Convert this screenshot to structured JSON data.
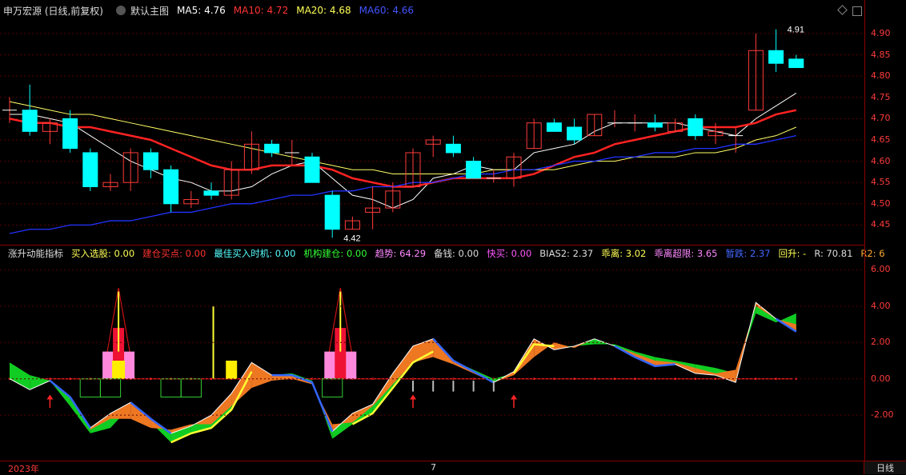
{
  "main_header": {
    "title": "申万宏源 (日线,前复权)",
    "preset": "默认主图",
    "ma5": "MA5: 4.76",
    "ma10": "MA10: 4.72",
    "ma20": "MA20: 4.68",
    "ma60": "MA60: 4.66"
  },
  "sub_header": {
    "title": "涨升动能指标",
    "buy_select": "买入选股: 0.00",
    "build_point": "建仓买点: 0.00",
    "best_time": "最佳买入时机: 0.00",
    "inst_build": "机构建仓: 0.00",
    "trend": "趋势: 64.29",
    "reserve": "备钱: 0.00",
    "fast_buy": "快买: 0.00",
    "bias2": "BIAS2: 2.37",
    "deviation": "乖离: 3.02",
    "deviation_limit": "乖离超限: 3.65",
    "fall": "暂跌: 2.37",
    "rise": "回升: -",
    "r": "R: 70.81",
    "r2": "R2: 6"
  },
  "main_axis": {
    "ticks": [
      "4.90",
      "4.85",
      "4.80",
      "4.75",
      "4.70",
      "4.65",
      "4.60",
      "4.55",
      "4.50",
      "4.45"
    ],
    "values": [
      4.9,
      4.85,
      4.8,
      4.75,
      4.7,
      4.65,
      4.6,
      4.55,
      4.5,
      4.45
    ]
  },
  "sub_axis": {
    "ticks": [
      "6.00",
      "4.00",
      "2.00",
      "0.00",
      "-2.00"
    ],
    "values": [
      6,
      4,
      2,
      0,
      -2
    ]
  },
  "annotations": {
    "high": "4.91",
    "low": "4.42"
  },
  "date_bar": {
    "start": "2023年",
    "mid": "7",
    "period": "日线"
  },
  "colors": {
    "up": "#ff3b3b",
    "down": "#00ffff",
    "ma5": "#ffffff",
    "ma10": "#ff2222",
    "ma20": "#ffff66",
    "ma60": "#2233ff",
    "bg": "#000000",
    "grid": "#5a0000"
  },
  "chart_data": [
    {
      "type": "candlestick",
      "title": "申万宏源 (日线,前复权)",
      "ylim": [
        4.4,
        4.93
      ],
      "candles": [
        {
          "o": 4.72,
          "c": 4.72,
          "h": 4.75,
          "l": 4.69
        },
        {
          "o": 4.72,
          "c": 4.67,
          "h": 4.78,
          "l": 4.66
        },
        {
          "o": 4.67,
          "c": 4.69,
          "h": 4.7,
          "l": 4.64
        },
        {
          "o": 4.7,
          "c": 4.63,
          "h": 4.72,
          "l": 4.62
        },
        {
          "o": 4.62,
          "c": 4.54,
          "h": 4.63,
          "l": 4.53
        },
        {
          "o": 4.54,
          "c": 4.55,
          "h": 4.57,
          "l": 4.53
        },
        {
          "o": 4.55,
          "c": 4.62,
          "h": 4.63,
          "l": 4.53
        },
        {
          "o": 4.62,
          "c": 4.58,
          "h": 4.63,
          "l": 4.56
        },
        {
          "o": 4.58,
          "c": 4.5,
          "h": 4.59,
          "l": 4.48
        },
        {
          "o": 4.5,
          "c": 4.51,
          "h": 4.53,
          "l": 4.49
        },
        {
          "o": 4.53,
          "c": 4.52,
          "h": 4.55,
          "l": 4.51
        },
        {
          "o": 4.52,
          "c": 4.58,
          "h": 4.6,
          "l": 4.51
        },
        {
          "o": 4.58,
          "c": 4.64,
          "h": 4.67,
          "l": 4.57
        },
        {
          "o": 4.64,
          "c": 4.62,
          "h": 4.65,
          "l": 4.61
        },
        {
          "o": 4.62,
          "c": 4.62,
          "h": 4.65,
          "l": 4.59
        },
        {
          "o": 4.61,
          "c": 4.55,
          "h": 4.62,
          "l": 4.55
        },
        {
          "o": 4.52,
          "c": 4.44,
          "h": 4.53,
          "l": 4.42
        },
        {
          "o": 4.44,
          "c": 4.46,
          "h": 4.47,
          "l": 4.44
        },
        {
          "o": 4.48,
          "c": 4.49,
          "h": 4.54,
          "l": 4.44
        },
        {
          "o": 4.49,
          "c": 4.53,
          "h": 4.55,
          "l": 4.48
        },
        {
          "o": 4.54,
          "c": 4.62,
          "h": 4.63,
          "l": 4.54
        },
        {
          "o": 4.64,
          "c": 4.65,
          "h": 4.66,
          "l": 4.61
        },
        {
          "o": 4.64,
          "c": 4.62,
          "h": 4.66,
          "l": 4.61
        },
        {
          "o": 4.6,
          "c": 4.56,
          "h": 4.61,
          "l": 4.56
        },
        {
          "o": 4.56,
          "c": 4.56,
          "h": 4.58,
          "l": 4.55
        },
        {
          "o": 4.56,
          "c": 4.61,
          "h": 4.62,
          "l": 4.54
        },
        {
          "o": 4.63,
          "c": 4.69,
          "h": 4.7,
          "l": 4.63
        },
        {
          "o": 4.69,
          "c": 4.67,
          "h": 4.7,
          "l": 4.67
        },
        {
          "o": 4.68,
          "c": 4.65,
          "h": 4.7,
          "l": 4.64
        },
        {
          "o": 4.66,
          "c": 4.71,
          "h": 4.71,
          "l": 4.66
        },
        {
          "o": 4.69,
          "c": 4.69,
          "h": 4.72,
          "l": 4.68
        },
        {
          "o": 4.69,
          "c": 4.69,
          "h": 4.71,
          "l": 4.67
        },
        {
          "o": 4.69,
          "c": 4.68,
          "h": 4.71,
          "l": 4.67
        },
        {
          "o": 4.67,
          "c": 4.69,
          "h": 4.7,
          "l": 4.67
        },
        {
          "o": 4.7,
          "c": 4.66,
          "h": 4.71,
          "l": 4.65
        },
        {
          "o": 4.66,
          "c": 4.67,
          "h": 4.69,
          "l": 4.64
        },
        {
          "o": 4.66,
          "c": 4.66,
          "h": 4.68,
          "l": 4.62
        },
        {
          "o": 4.72,
          "c": 4.86,
          "h": 4.9,
          "l": 4.72
        },
        {
          "o": 4.86,
          "c": 4.83,
          "h": 4.91,
          "l": 4.81
        },
        {
          "o": 4.84,
          "c": 4.82,
          "h": 4.85,
          "l": 4.82
        }
      ],
      "series": [
        {
          "name": "MA5",
          "values": [
            4.71,
            4.71,
            4.7,
            4.69,
            4.66,
            4.63,
            4.6,
            4.58,
            4.56,
            4.55,
            4.53,
            4.53,
            4.54,
            4.57,
            4.59,
            4.6,
            4.56,
            4.52,
            4.51,
            4.49,
            4.51,
            4.56,
            4.57,
            4.59,
            4.58,
            4.58,
            4.62,
            4.63,
            4.64,
            4.67,
            4.69,
            4.69,
            4.69,
            4.69,
            4.68,
            4.67,
            4.66,
            4.7,
            4.73,
            4.76
          ]
        },
        {
          "name": "MA10",
          "values": [
            4.7,
            4.69,
            4.69,
            4.68,
            4.68,
            4.67,
            4.66,
            4.65,
            4.63,
            4.61,
            4.59,
            4.58,
            4.58,
            4.59,
            4.59,
            4.59,
            4.58,
            4.56,
            4.55,
            4.54,
            4.54,
            4.55,
            4.56,
            4.56,
            4.56,
            4.56,
            4.57,
            4.59,
            4.61,
            4.62,
            4.64,
            4.65,
            4.66,
            4.67,
            4.68,
            4.68,
            4.68,
            4.69,
            4.71,
            4.72
          ]
        },
        {
          "name": "MA20",
          "values": [
            4.74,
            4.73,
            4.72,
            4.71,
            4.71,
            4.7,
            4.69,
            4.68,
            4.67,
            4.66,
            4.65,
            4.64,
            4.63,
            4.62,
            4.61,
            4.6,
            4.59,
            4.58,
            4.58,
            4.57,
            4.57,
            4.57,
            4.57,
            4.57,
            4.58,
            4.58,
            4.58,
            4.58,
            4.59,
            4.6,
            4.6,
            4.61,
            4.61,
            4.61,
            4.62,
            4.62,
            4.63,
            4.65,
            4.66,
            4.68
          ]
        },
        {
          "name": "MA60",
          "values": [
            4.43,
            4.44,
            4.44,
            4.45,
            4.45,
            4.46,
            4.46,
            4.47,
            4.48,
            4.48,
            4.49,
            4.5,
            4.5,
            4.51,
            4.52,
            4.52,
            4.53,
            4.53,
            4.54,
            4.54,
            4.55,
            4.55,
            4.56,
            4.57,
            4.57,
            4.58,
            4.58,
            4.59,
            4.6,
            4.6,
            4.61,
            4.61,
            4.62,
            4.62,
            4.63,
            4.63,
            4.64,
            4.64,
            4.65,
            4.66
          ]
        }
      ]
    },
    {
      "type": "area",
      "title": "涨升动能指标",
      "ylim": [
        -4.5,
        6.5
      ],
      "series": [
        {
          "name": "white",
          "values": [
            0.0,
            -0.6,
            -0.1,
            -1.0,
            -2.7,
            -1.9,
            -1.3,
            -2.2,
            -3.0,
            -2.6,
            -2.0,
            -0.8,
            0.9,
            0.2,
            0.2,
            -0.2,
            -2.9,
            -1.9,
            -1.4,
            0.3,
            1.8,
            2.2,
            1.0,
            0.4,
            -0.2,
            0.4,
            2.2,
            1.6,
            1.8,
            2.2,
            1.8,
            1.2,
            0.7,
            0.8,
            0.3,
            0.2,
            -0.2,
            4.2,
            3.3,
            2.6
          ]
        },
        {
          "name": "green",
          "values": [
            0.9,
            0.2,
            -0.1,
            -1.5,
            -3.0,
            -2.7,
            -1.5,
            -2.4,
            -3.5,
            -3.0,
            -2.7,
            -1.7,
            0.4,
            0.2,
            0.3,
            -0.1,
            -3.3,
            -2.5,
            -1.9,
            -0.5,
            0.9,
            1.5,
            1.0,
            0.5,
            0.0,
            0.3,
            1.9,
            1.8,
            1.8,
            1.9,
            1.9,
            1.5,
            1.2,
            1.0,
            0.8,
            0.6,
            0.3,
            3.6,
            3.1,
            3.6
          ]
        },
        {
          "name": "orange",
          "values": [
            null,
            null,
            null,
            null,
            -2.8,
            -2.2,
            -2.2,
            -2.7,
            -2.8,
            -2.5,
            -2.5,
            -1.5,
            -0.5,
            -0.1,
            0.0,
            -0.3,
            -2.5,
            -2.4,
            -1.5,
            -0.3,
            0.9,
            1.2,
            0.8,
            0.3,
            -0.2,
            0.2,
            1.2,
            2.0,
            1.7,
            2.2,
            1.8,
            1.4,
            1.0,
            0.9,
            0.6,
            0.3,
            0.5,
            4.0,
            3.3,
            3.0
          ]
        }
      ]
    }
  ]
}
